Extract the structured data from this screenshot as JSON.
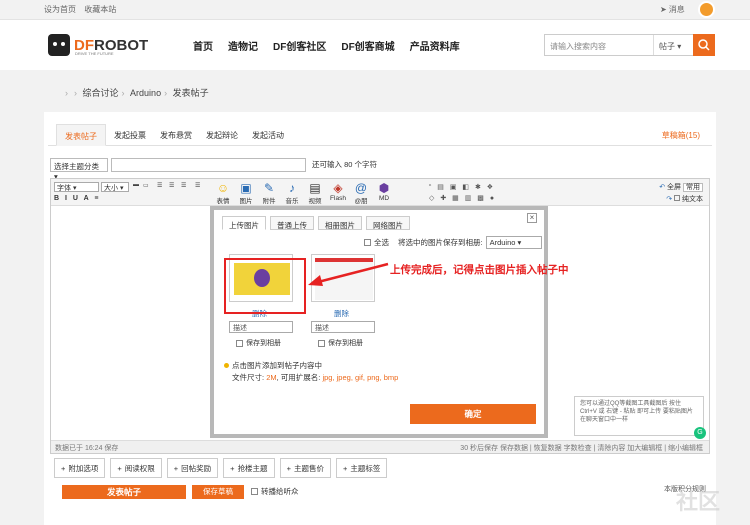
{
  "topbar": {
    "set_home": "设为首页",
    "bookmark": "收藏本站",
    "messages": "消息"
  },
  "header": {
    "logo_df": "DF",
    "logo_robot": "ROBOT",
    "tagline": "DRIVE THE FUTURE",
    "nav": [
      "首页",
      "造物记",
      "DF创客社区",
      "DF创客商城",
      "产品资料库"
    ],
    "search_placeholder": "请输入搜索内容",
    "search_scope": "帖子"
  },
  "breadcrumb": [
    "综合讨论",
    "Arduino",
    "发表帖子"
  ],
  "tabs": [
    "发表帖子",
    "发起投票",
    "发布悬赏",
    "发起辩论",
    "发起活动"
  ],
  "draft_box": "草稿箱(15)",
  "subject": {
    "category": "选择主题分类",
    "hint": "还可输入 80 个字符"
  },
  "toolbar": {
    "font": "字体",
    "size": "大小",
    "format_row": "B I U A ≡",
    "big_icons": [
      {
        "label": "表情",
        "icon": "smile-icon",
        "glyph": "☺"
      },
      {
        "label": "图片",
        "icon": "image-icon",
        "glyph": "▣"
      },
      {
        "label": "附件",
        "icon": "attachment-icon",
        "glyph": "✎"
      },
      {
        "label": "音乐",
        "icon": "music-icon",
        "glyph": "♪"
      },
      {
        "label": "视频",
        "icon": "video-icon",
        "glyph": "▤"
      },
      {
        "label": "Flash",
        "icon": "flash-icon",
        "glyph": "◈"
      },
      {
        "label": "@朋",
        "icon": "at-icon",
        "glyph": "@"
      },
      {
        "label": "MD",
        "icon": "markdown-icon",
        "glyph": "⬢"
      }
    ],
    "fullscreen": "全屏",
    "common": "常用",
    "plain_text": "纯文本"
  },
  "status": {
    "saved": "数据已于 16:24 保存",
    "right": "30 秒后保存 保存数据 | 恢复数据    字数检查 | 清除内容    加大编辑框 | 缩小编辑框"
  },
  "dialog": {
    "tabs": [
      "上传图片",
      "普通上传",
      "相册图片",
      "网络图片"
    ],
    "select_all": "全选",
    "save_selected": "将选中的图片保存到相册:",
    "album": "Arduino",
    "delete": "删除",
    "desc_placeholder": "描述",
    "save_to_album": "保存到相册",
    "tip": "点击图片添加到帖子内容中",
    "file_size_label": "文件尺寸:",
    "file_size": "2M",
    "ext_label": ", 可用扩展名:",
    "extensions": "jpg, jpeg, gif, png, bmp",
    "confirm": "确定"
  },
  "annotation": "上传完成后，记得点击图片插入帖子中",
  "tooltip": "您可以通过QQ等截图工具截图后 按住 Ctrl+V 或 右键 - 粘贴 即可上传 要粘贴图片在聊天窗口中一样",
  "options": [
    "附加选项",
    "阅读权限",
    "回帖奖励",
    "抢楼主题",
    "主题售价",
    "主题标签"
  ],
  "submit": "发表帖子",
  "save_draft": "保存草稿",
  "forward": "转播给听众",
  "block_note": "本版积分规则",
  "colors": {
    "accent": "#ec6a1d",
    "annotation": "#e62222",
    "link": "#2a6bb3"
  }
}
